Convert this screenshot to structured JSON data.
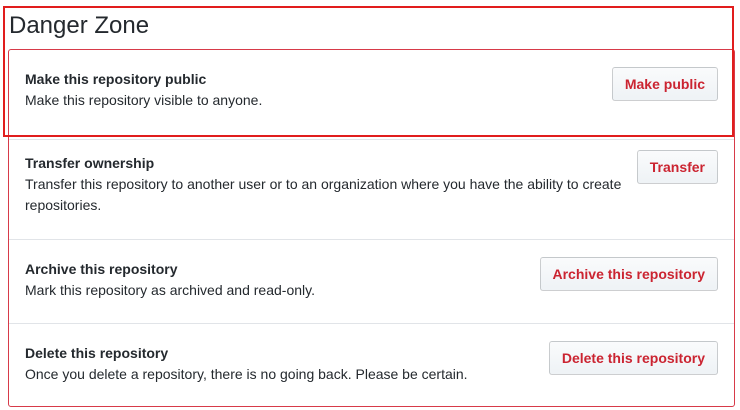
{
  "section": {
    "title": "Danger Zone"
  },
  "rows": [
    {
      "title": "Make this repository public",
      "description": "Make this repository visible to anyone.",
      "button": "Make public"
    },
    {
      "title": "Transfer ownership",
      "description": "Transfer this repository to another user or to an organization where you have the ability to create repositories.",
      "button": "Transfer"
    },
    {
      "title": "Archive this repository",
      "description": "Mark this repository as archived and read-only.",
      "button": "Archive this repository"
    },
    {
      "title": "Delete this repository",
      "description": "Once you delete a repository, there is no going back. Please be certain.",
      "button": "Delete this repository"
    }
  ],
  "colors": {
    "danger_border": "#d73a49",
    "danger_text": "#cb2431",
    "highlight_outline": "#e11d1d"
  }
}
